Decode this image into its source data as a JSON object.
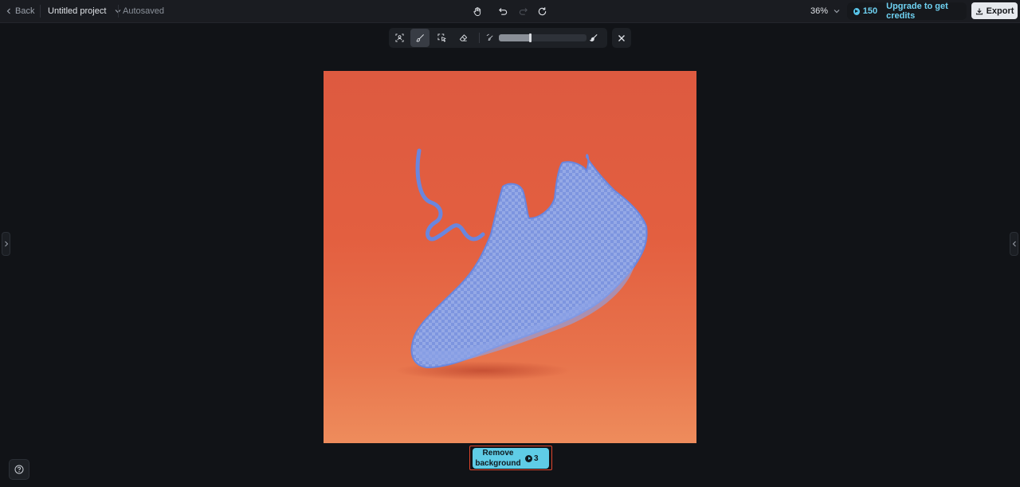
{
  "header": {
    "back_label": "Back",
    "project_name": "Untitled project",
    "save_status": "Autosaved",
    "zoom_level": "36%",
    "credits_count": "150",
    "upgrade_label": "Upgrade to get credits",
    "export_label": "Export"
  },
  "brush_toolbar": {
    "tools": [
      "subject-select",
      "brush",
      "lasso-select",
      "eraser"
    ],
    "active_tool": "brush",
    "brush_size_fraction": 0.35
  },
  "actions": {
    "remove_bg_line1": "Remove",
    "remove_bg_line2": "background",
    "remove_bg_cost": "3"
  },
  "colors": {
    "accent": "#5fcce6",
    "highlight_border": "#e0452c",
    "canvas_background": "#e35f40",
    "mask_overlay": "#7b93e0"
  },
  "icons": [
    "chevron-left-icon",
    "chevron-down-icon",
    "hand-icon",
    "undo-icon",
    "redo-icon",
    "refresh-icon",
    "coin-icon",
    "download-icon",
    "close-icon",
    "help-icon"
  ]
}
